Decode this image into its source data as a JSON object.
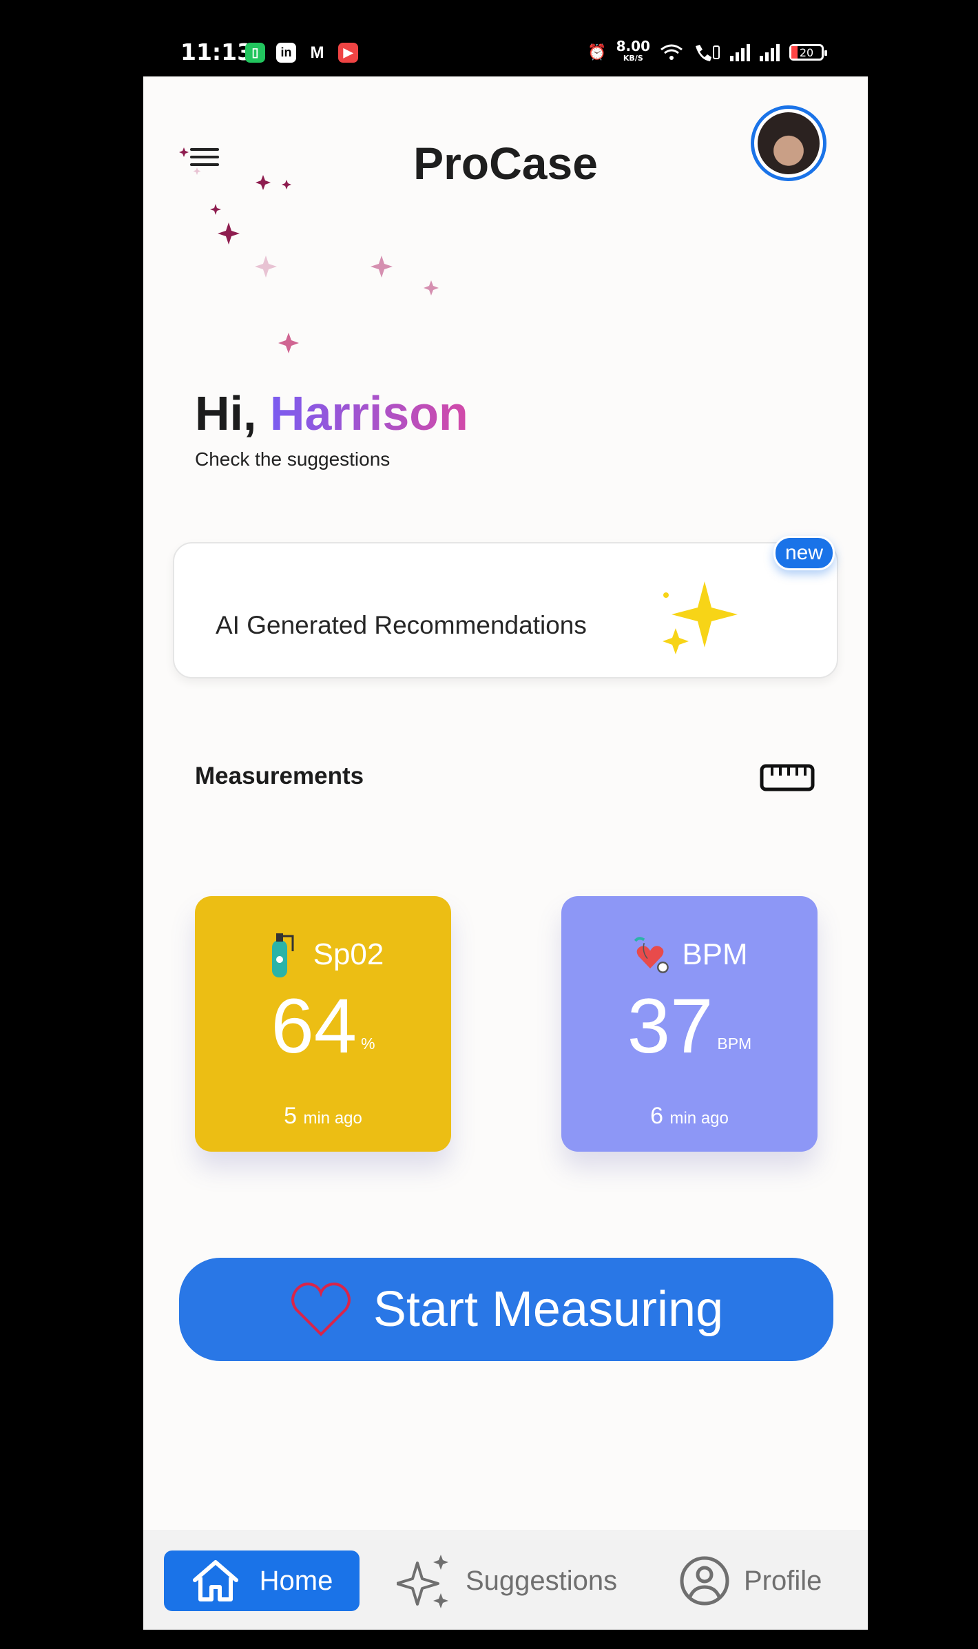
{
  "status_bar": {
    "time": "11:13",
    "net_speed_value": "8.00",
    "net_speed_unit": "KB/S",
    "battery": "20",
    "notification_icons": [
      "messages-icon",
      "linkedin-icon",
      "gmail-icon",
      "recorder-icon"
    ]
  },
  "header": {
    "title": "ProCase",
    "menu_icon": "menu-icon",
    "avatar": "profile-avatar"
  },
  "greeting": {
    "hi": "Hi,",
    "name": "Harrison",
    "subtitle": "Check the suggestions"
  },
  "recommendation_card": {
    "label": "AI Generated Recommendations",
    "badge": "new",
    "icon": "sparkle-icon"
  },
  "measurements": {
    "title": "Measurements",
    "icon": "ruler-icon",
    "cards": [
      {
        "label": "Sp02",
        "value": "64",
        "unit": "%",
        "time_value": "5",
        "time_suffix": "min ago",
        "color": "#ecbe14",
        "icon": "oxygen-tank-icon"
      },
      {
        "label": "BPM",
        "value": "37",
        "unit": "BPM",
        "time_value": "6",
        "time_suffix": "min ago",
        "color": "#8d97f6",
        "icon": "heart-stethoscope-icon"
      }
    ]
  },
  "action": {
    "label": "Start Measuring",
    "icon": "heart-outline-icon",
    "color": "#2977e6"
  },
  "bottom_nav": {
    "items": [
      {
        "label": "Home",
        "icon": "home-icon",
        "active": true
      },
      {
        "label": "Suggestions",
        "icon": "sparkle-icon",
        "active": false
      },
      {
        "label": "Profile",
        "icon": "profile-icon",
        "active": false
      }
    ]
  },
  "colors": {
    "accent": "#1a73e8",
    "greeting_gradient_start": "#7a5cf0",
    "greeting_gradient_end": "#d24aa8"
  }
}
